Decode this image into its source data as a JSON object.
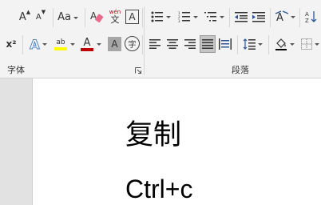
{
  "ribbon": {
    "font_group_label": "字体",
    "paragraph_group_label": "段落",
    "font": {
      "grow_label": "A",
      "shrink_label": "A",
      "change_case_label": "Aa",
      "phonetic_guide_top": "wén",
      "phonetic_guide_bottom": "文",
      "char_border_label": "A",
      "superscript_label": "x²",
      "text_effects_label": "A",
      "highlight_label": "ab",
      "font_color_label": "A",
      "char_shading_label": "A",
      "enclose_char_label": "字"
    },
    "colors": {
      "highlight": "#ffff00",
      "font_color": "#c00000",
      "text_effects": "#4a7fc4"
    }
  },
  "document": {
    "lines": [
      "复制",
      "Ctrl+c"
    ]
  }
}
